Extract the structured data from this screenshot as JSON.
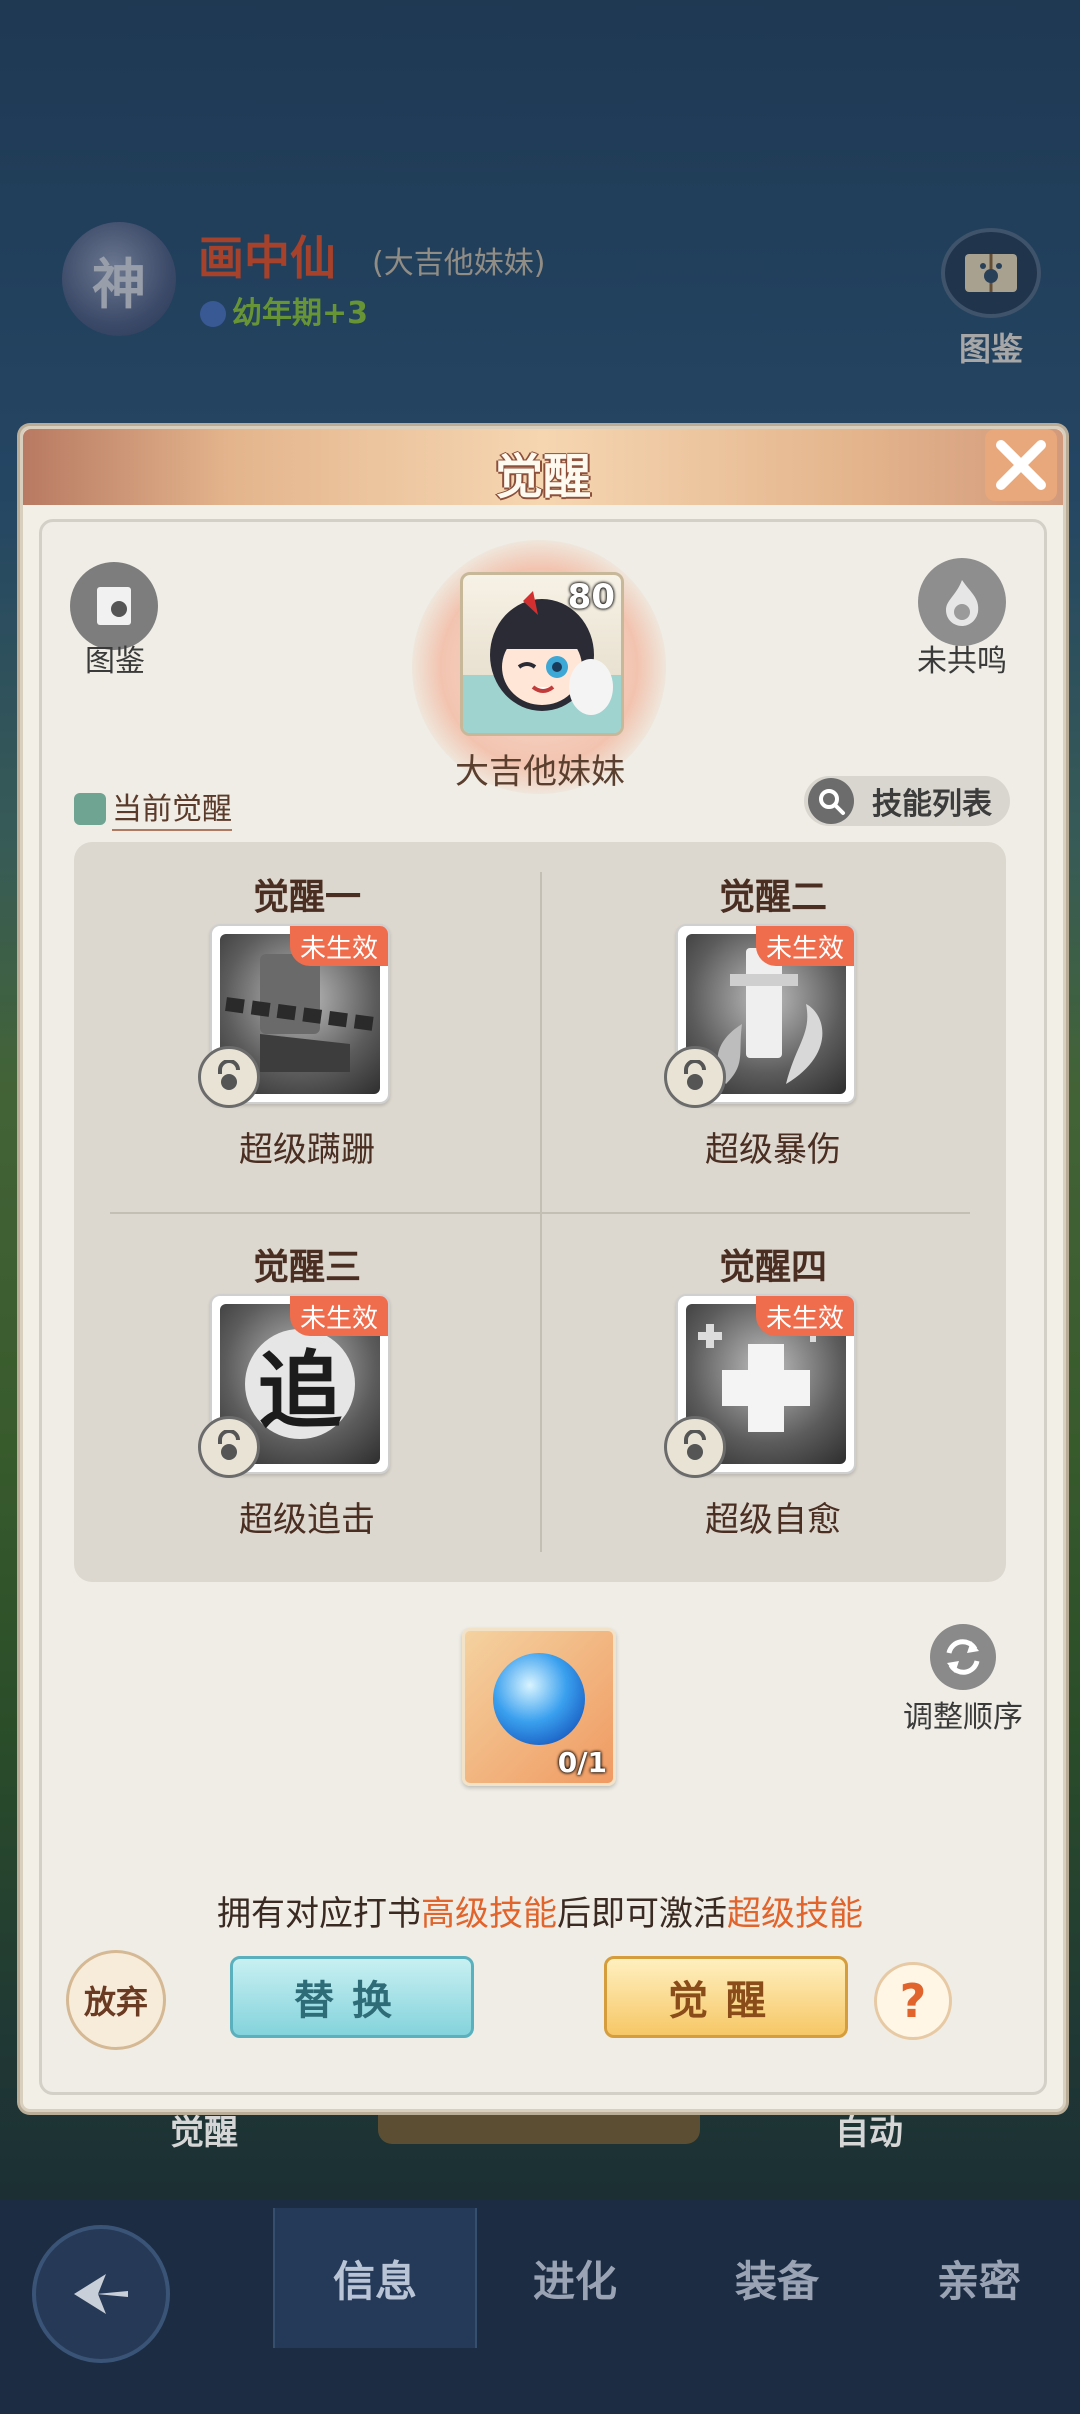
{
  "background": {
    "badge": "神",
    "pet_name": "画中仙",
    "pet_nick": "(大吉他妹妹)",
    "stage": "幼年期+3",
    "tujian": "图鉴",
    "bottom_left": "觉醒",
    "bottom_right": "自动"
  },
  "nav": {
    "tabs": [
      {
        "label": "信息"
      },
      {
        "label": "进化"
      },
      {
        "label": "装备"
      },
      {
        "label": "亲密"
      }
    ]
  },
  "modal": {
    "title": "觉醒",
    "close_icon": "close-x-icon",
    "tujian_label": "图鉴",
    "resonance_label": "未共鸣",
    "pet": {
      "level": "80",
      "name": "大吉他妹妹"
    },
    "current_awaken": "当前觉醒",
    "skill_list": "技能列表",
    "slots": [
      {
        "title": "觉醒一",
        "status": "未生效",
        "skill": "超级蹒跚",
        "icon": "shackled-boot-icon"
      },
      {
        "title": "觉醒二",
        "status": "未生效",
        "skill": "超级暴伤",
        "icon": "sword-flame-icon"
      },
      {
        "title": "觉醒三",
        "status": "未生效",
        "skill": "超级追击",
        "icon": "chase-icon"
      },
      {
        "title": "觉醒四",
        "status": "未生效",
        "skill": "超级自愈",
        "icon": "heal-cross-icon"
      }
    ],
    "chase_glyph": "追",
    "item": {
      "count": "0/1",
      "icon": "blue-orb-icon"
    },
    "reorder": "调整顺序",
    "hint": {
      "pre": "拥有对应打书",
      "hl1": "高级技能",
      "mid": "后即可激活",
      "hl2": "超级技能"
    },
    "abandon": "放弃",
    "replace": "替换",
    "awaken": "觉醒",
    "help": "?"
  },
  "colors": {
    "accent": "#e0642c",
    "badge_red": "#ef6d4d",
    "header": "#e4b58d"
  }
}
